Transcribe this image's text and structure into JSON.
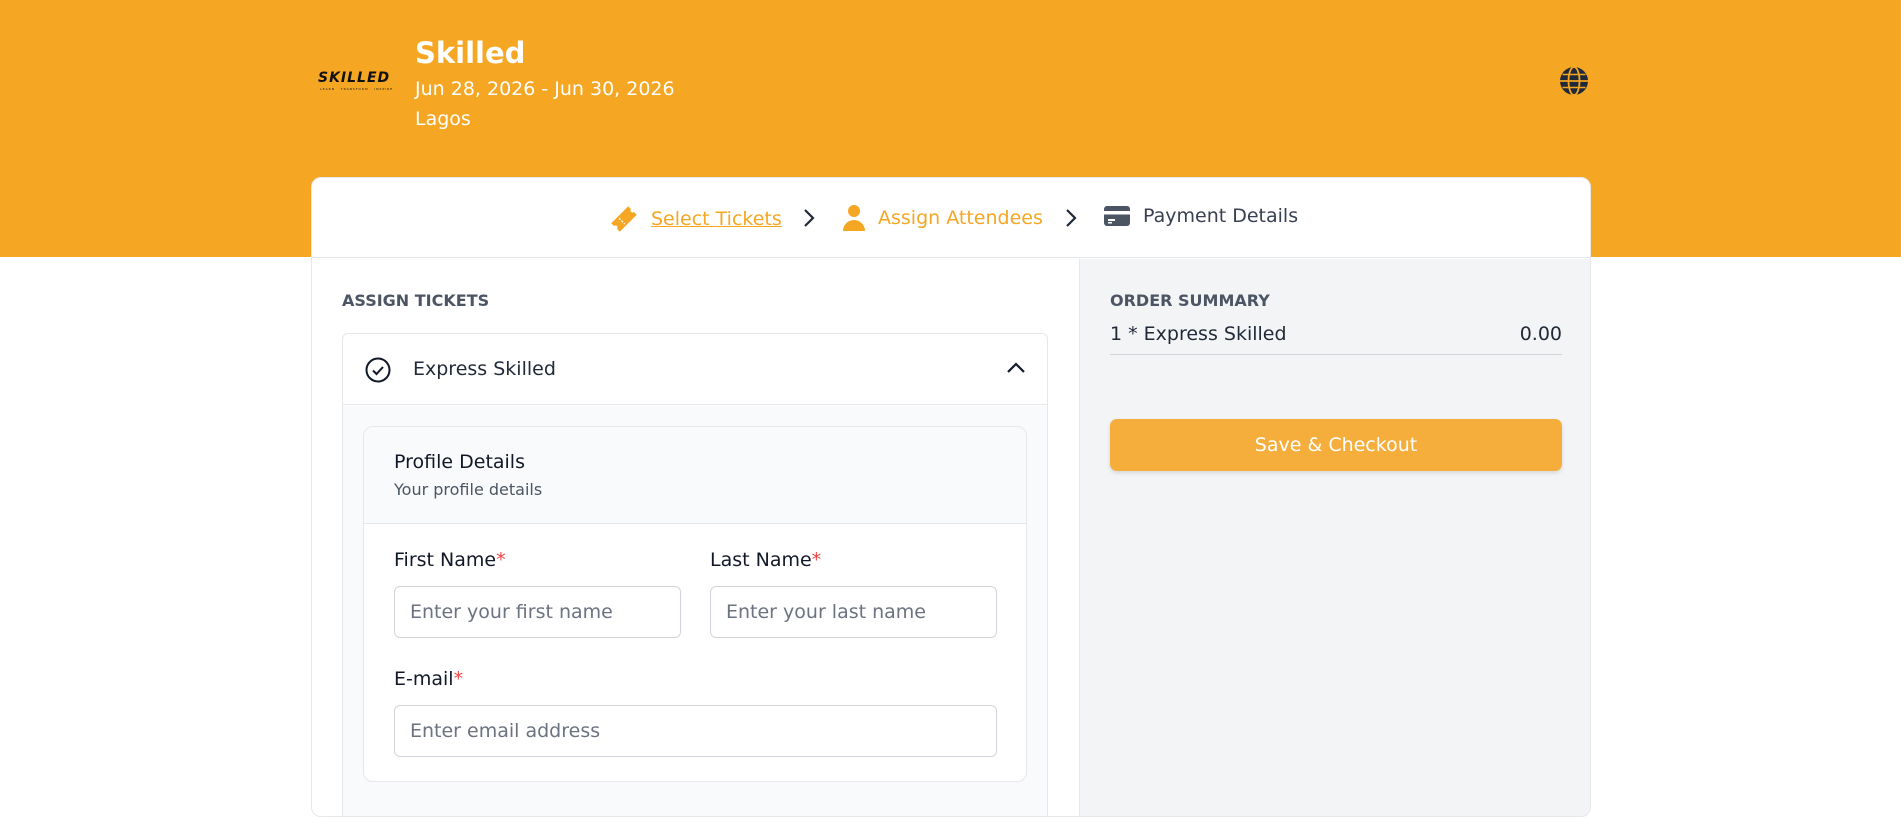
{
  "event": {
    "logo_text": "SKILLED",
    "logo_tagline": "LEARN · TRANSFORM · INSPIRE",
    "title": "Skilled",
    "dates": "Jun 28, 2026 - Jun 30, 2026",
    "location": "Lagos"
  },
  "stepper": {
    "steps": [
      {
        "label": "Select Tickets",
        "icon": "ticket-icon",
        "state": "completed"
      },
      {
        "label": "Assign Attendees",
        "icon": "person-icon",
        "state": "active"
      },
      {
        "label": "Payment Details",
        "icon": "credit-card-icon",
        "state": "pending"
      }
    ]
  },
  "assign": {
    "section_title": "ASSIGN TICKETS",
    "ticket_name": "Express Skilled",
    "profile": {
      "title": "Profile Details",
      "subtitle": "Your profile details",
      "first_name": {
        "label": "First Name",
        "required_mark": "*",
        "placeholder": "Enter your first name",
        "value": ""
      },
      "last_name": {
        "label": "Last Name",
        "required_mark": "*",
        "placeholder": "Enter your last name",
        "value": ""
      },
      "email": {
        "label": "E-mail",
        "required_mark": "*",
        "placeholder": "Enter email address",
        "value": ""
      }
    }
  },
  "summary": {
    "title": "ORDER SUMMARY",
    "items": [
      {
        "label": "1 * Express Skilled",
        "price": "0.00"
      }
    ],
    "checkout_label": "Save & Checkout"
  },
  "colors": {
    "accent": "#f5a623",
    "required": "#ef4444",
    "button": "#f5ae3c"
  }
}
